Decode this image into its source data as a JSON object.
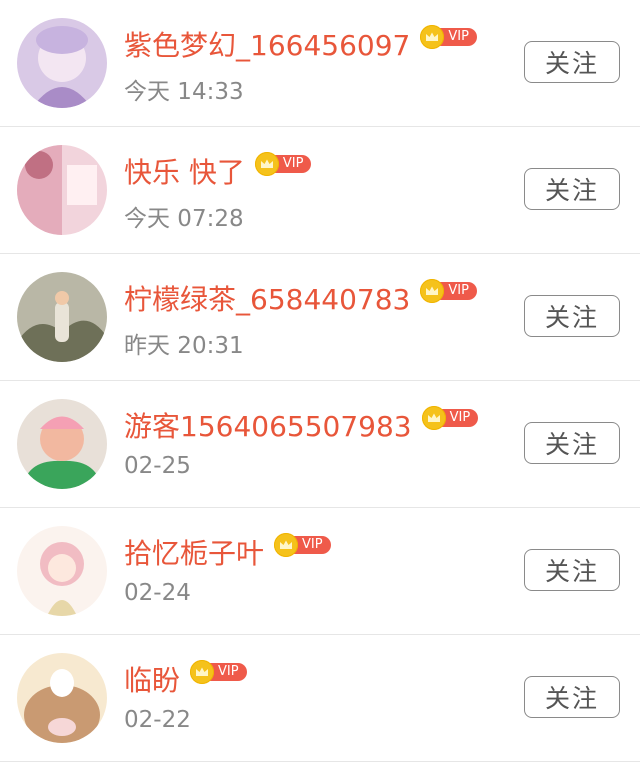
{
  "follows": [
    {
      "name": "紫色梦幻_166456097",
      "time": "今天 14:33",
      "vip": "VIP",
      "button": "关注",
      "avatar_colors": [
        "#d9c9e6",
        "#a98cc7",
        "#f3e6f2"
      ]
    },
    {
      "name": "快乐 快了",
      "time": "今天 07:28",
      "vip": "VIP",
      "button": "关注",
      "avatar_colors": [
        "#f2d4dc",
        "#d98aa0",
        "#fff0f2"
      ]
    },
    {
      "name": "柠檬绿茶_658440783",
      "time": "昨天 20:31",
      "vip": "VIP",
      "button": "关注",
      "avatar_colors": [
        "#b9b7a6",
        "#6e7058",
        "#e9e4d8"
      ]
    },
    {
      "name": "游客1564065507983",
      "time": "02-25",
      "vip": "VIP",
      "button": "关注",
      "avatar_colors": [
        "#e8e0d8",
        "#3aa55b",
        "#f2b8a0"
      ]
    },
    {
      "name": "拾忆栀子叶",
      "time": "02-24",
      "vip": "VIP",
      "button": "关注",
      "avatar_colors": [
        "#fbf3ee",
        "#f1bcc3",
        "#e7d7a8"
      ]
    },
    {
      "name": "临盼",
      "time": "02-22",
      "vip": "VIP",
      "button": "关注",
      "avatar_colors": [
        "#f7e9d0",
        "#c99a72",
        "#f6d7d7"
      ]
    }
  ]
}
